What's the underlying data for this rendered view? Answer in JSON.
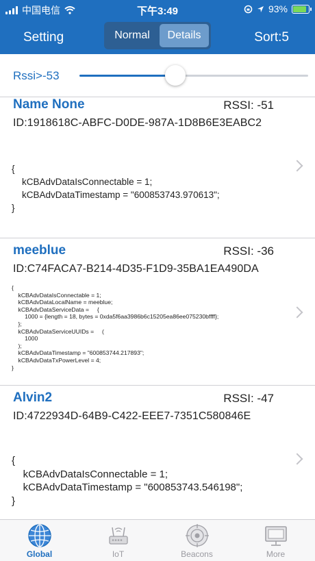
{
  "status_bar": {
    "carrier": "中国电信",
    "time": "下午3:49",
    "battery": "93%",
    "battery_level": 0.93
  },
  "nav": {
    "setting": "Setting",
    "segments": [
      "Normal",
      "Details"
    ],
    "selected_segment": "Details",
    "sort": "Sort:5"
  },
  "filter": {
    "label": "Rssi>-53",
    "slider_level": 0.42
  },
  "devices": [
    {
      "name": "Name None",
      "rssi": "RSSI: -51",
      "id": "ID:1918618C-ABFC-D0DE-987A-1D8B6E3EABC2",
      "adv": "{\n    kCBAdvDataIsConnectable = 1;\n    kCBAdvDataTimestamp = \"600853743.970613\";\n}"
    },
    {
      "name": "meeblue",
      "rssi": "RSSI: -36",
      "id": "ID:C74FACA7-B214-4D35-F1D9-35BA1EA490DA",
      "adv": "{\n    kCBAdvDataIsConnectable = 1;\n    kCBAdvDataLocalName = meeblue;\n    kCBAdvDataServiceData =     {\n        1000 = {length = 18, bytes = 0xda5f6aa3986b6c15205ea86ee075230bffff};\n    };\n    kCBAdvDataServiceUUIDs =     (\n        1000\n    );\n    kCBAdvDataTimestamp = \"600853744.217893\";\n    kCBAdvDataTxPowerLevel = 4;\n}"
    },
    {
      "name": "Alvin2",
      "rssi": "RSSI: -47",
      "id": "ID:4722934D-64B9-C422-EEE7-7351C580846E",
      "adv": "{\n    kCBAdvDataIsConnectable = 1;\n    kCBAdvDataTimestamp = \"600853743.546198\";\n}"
    }
  ],
  "tabs": [
    {
      "label": "Global",
      "icon": "globe-icon",
      "active": true
    },
    {
      "label": "IoT",
      "icon": "router-icon",
      "active": false
    },
    {
      "label": "Beacons",
      "icon": "beacon-icon",
      "active": false
    },
    {
      "label": "More",
      "icon": "monitor-icon",
      "active": false
    }
  ],
  "colors": {
    "primary": "#1f6fbf",
    "tab_inactive": "#9a9aa0"
  }
}
